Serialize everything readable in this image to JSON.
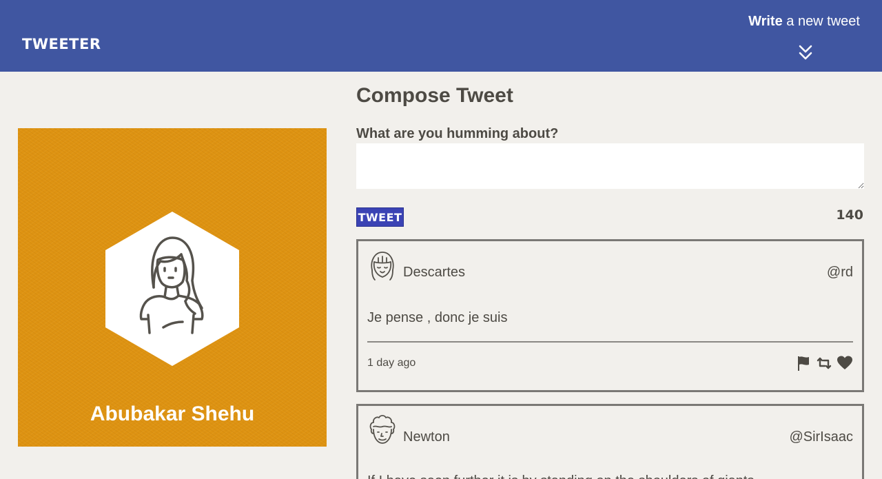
{
  "nav": {
    "brand": "TWEETER",
    "write_bold": "Write",
    "write_rest": " a new tweet"
  },
  "profile": {
    "name": "Abubakar Shehu",
    "background_color": "#de9312"
  },
  "compose": {
    "title": "Compose Tweet",
    "label": "What are you humming about?",
    "input_value": "",
    "button_label": "TWEET",
    "counter": "140"
  },
  "tweets": [
    {
      "name": "Descartes",
      "handle": "@rd",
      "text": "Je pense , donc je suis",
      "time": "1 day ago",
      "avatar_icon": "girl-avatar-icon"
    },
    {
      "name": "Newton",
      "handle": "@SirIsaac",
      "text": "If I have seen further it is by standing on the shoulders of giants",
      "avatar_icon": "curly-hair-avatar-icon"
    }
  ],
  "colors": {
    "nav": "#4056a1",
    "background": "#f2f0ec",
    "button": "#3b43b4",
    "text": "#4d4a44"
  }
}
